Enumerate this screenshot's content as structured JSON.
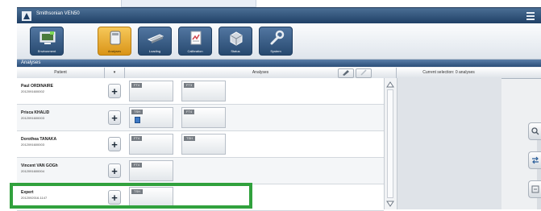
{
  "app": {
    "title": "Smithsonian VEN50"
  },
  "toolbar": {
    "items": [
      {
        "label": "Environment",
        "icon": "monitor-icon",
        "active": false
      },
      {
        "label": "Analyses",
        "icon": "analyses-icon",
        "active": true
      },
      {
        "label": "Loading",
        "icon": "loading-icon",
        "active": false
      },
      {
        "label": "Calibration",
        "icon": "calibration-icon",
        "active": false
      },
      {
        "label": "Status",
        "icon": "status-icon",
        "active": false
      },
      {
        "label": "System",
        "icon": "wrench-icon",
        "active": false
      }
    ]
  },
  "section": {
    "title": "Analyses"
  },
  "columns": {
    "patient": "Patient",
    "sort": "▾",
    "analyses": "Analyses",
    "selection": "Current selection: 0 analyses"
  },
  "patients": [
    {
      "name": "Paul ORDINAIRE",
      "id": "2012091600002",
      "tests": [
        "FT4",
        "FT3"
      ]
    },
    {
      "name": "Prisca KHALID",
      "id": "2012091600003",
      "tests": [
        "TSH",
        "FT4"
      ]
    },
    {
      "name": "Dorothea TANAKA",
      "id": "2012091600003",
      "tests": [
        "FT4",
        "TSH"
      ]
    },
    {
      "name": "Vincent VAN GOGh",
      "id": "2012091600004",
      "tests": [
        "FT4"
      ]
    },
    {
      "name": "Expert",
      "id": "2012092016-1147",
      "tests": [
        "TSH"
      ]
    }
  ],
  "colors": {
    "accent": "#2b4e78",
    "active_tool": "#f0b23c",
    "highlight": "#31a13d"
  }
}
